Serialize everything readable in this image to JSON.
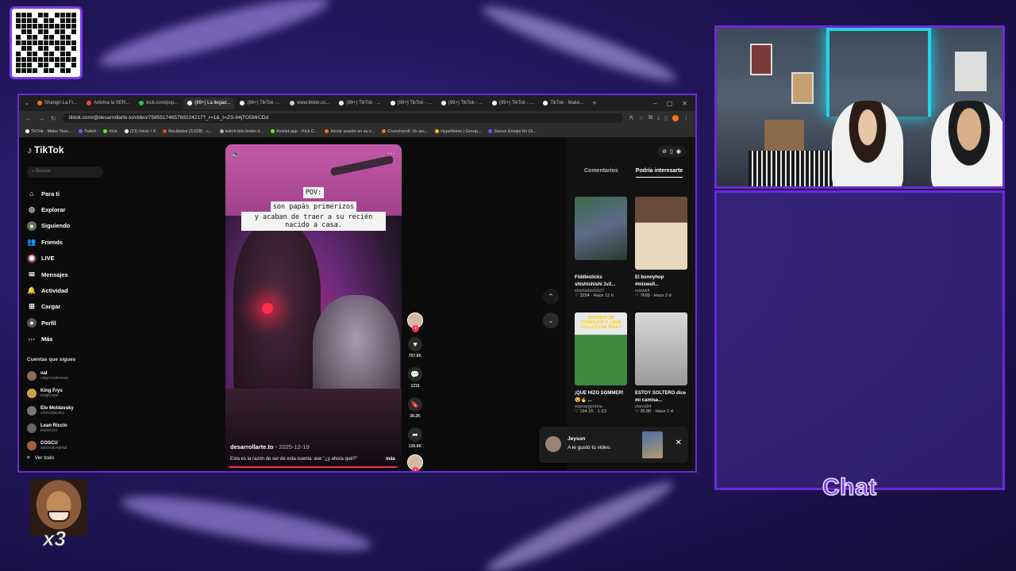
{
  "browser": {
    "tabs": [
      {
        "label": "Shangri-La Fr..."
      },
      {
        "label": "Adivina la SER..."
      },
      {
        "label": "kick.com/pop..."
      },
      {
        "label": "(99+) La llegad...",
        "active": true
      },
      {
        "label": "(99+) TikTok -..."
      },
      {
        "label": "www.tiktok.co..."
      },
      {
        "label": "(99+) TikTok - ..."
      },
      {
        "label": "(99+) TikTok - ..."
      },
      {
        "label": "(99+) TikTok - ..."
      },
      {
        "label": "(99+) TikTok - ..."
      },
      {
        "label": "TikTok - Make..."
      }
    ],
    "new_tab": "+",
    "url": "tiktok.com/@desarrollarte.to/video/7585517465769224217?_r=1&_t=ZS-94jTO5MrCDd",
    "bookmarks": [
      "TikTok - Make Your...",
      "Twitch",
      "Kick",
      "(21) Inicio / X",
      "Recibidos (3,628) - c...",
      "twitch bits botón d...",
      "Kicklet.app - Kick C...",
      "Iniciar sesión en su c...",
      "Crunchyroll: Ve ani...",
      "HypeNoise | Group...",
      "Dance Emojis for Di..."
    ]
  },
  "tiktok": {
    "logo": "TikTok",
    "search_placeholder": "Buscar",
    "menu": [
      {
        "label": "Para ti",
        "icon": "home-icon"
      },
      {
        "label": "Explorar",
        "icon": "compass-icon"
      },
      {
        "label": "Siguiendo",
        "icon": "following-icon"
      },
      {
        "label": "Friends",
        "icon": "friends-icon"
      },
      {
        "label": "LIVE",
        "icon": "live-icon"
      },
      {
        "label": "Mensajes",
        "icon": "message-icon"
      },
      {
        "label": "Actividad",
        "icon": "bell-icon"
      },
      {
        "label": "Cargar",
        "icon": "upload-icon"
      },
      {
        "label": "Perfil",
        "icon": "profile-icon"
      },
      {
        "label": "Más",
        "icon": "more-icon"
      }
    ],
    "following_title": "Cuentas que sigues",
    "following": [
      {
        "name": "val",
        "handle": "valgonzaleeeaa"
      },
      {
        "name": "King Frys",
        "handle": "kingfryspe"
      },
      {
        "name": "Elo Moldavsky",
        "handle": "elomoldavsky"
      },
      {
        "name": "Lean Riccio",
        "handle": "leanriccio"
      },
      {
        "name": "COSCU",
        "handle": "adictoalvegetal"
      }
    ],
    "see_all": "Ver todo",
    "video": {
      "caption_lines": [
        "POV:",
        "son papás primerizos",
        "y acaban de traer a su recién nacido a casa."
      ],
      "author": "desarrollarte.to",
      "date": "2025-12-19",
      "description": "Esta es la razón de ser de esta cuenta: ese \"¿y ahora qué?\"",
      "more": "más",
      "progress": 0.97
    },
    "actions": {
      "likes": "707.6K",
      "comments": "1216",
      "saves": "38.2K",
      "shares": "130.6K"
    },
    "panel_tabs": [
      "Comentarios",
      "Podría interesarte"
    ],
    "cards": [
      {
        "title": "Fiddlesticks shishishishi 1v2...",
        "user": "shishishishi107",
        "likes": "3254",
        "time": "Hace 12 h"
      },
      {
        "title": "El bunnyhop #mixwell...",
        "user": "mixwell",
        "likes": "7699",
        "time": "Hace 2 d"
      },
      {
        "title": "¡QUÉ HIZO SOMMER! 😮🔥 ...",
        "user": "espnargentina",
        "likes": "194.1K",
        "time": "1-23"
      },
      {
        "title": "ESTOY SOLTERO dice mi camisa...",
        "user": "zbeck84",
        "likes": "35.8K",
        "time": "Hace 2 d"
      }
    ],
    "card_overlay": "SUMMER SE COMPLICÓ Y ¿QUÉ GOLAZO DE PISA?",
    "toast": {
      "name": "Jeyson",
      "message": "A le gustó tu video."
    }
  },
  "stream": {
    "chat_title": "Chat",
    "emote_count": "x3"
  },
  "colors": {
    "accent": "#6d28d9",
    "tiktok_red": "#fe2c55",
    "neon": "#22d3ee"
  }
}
